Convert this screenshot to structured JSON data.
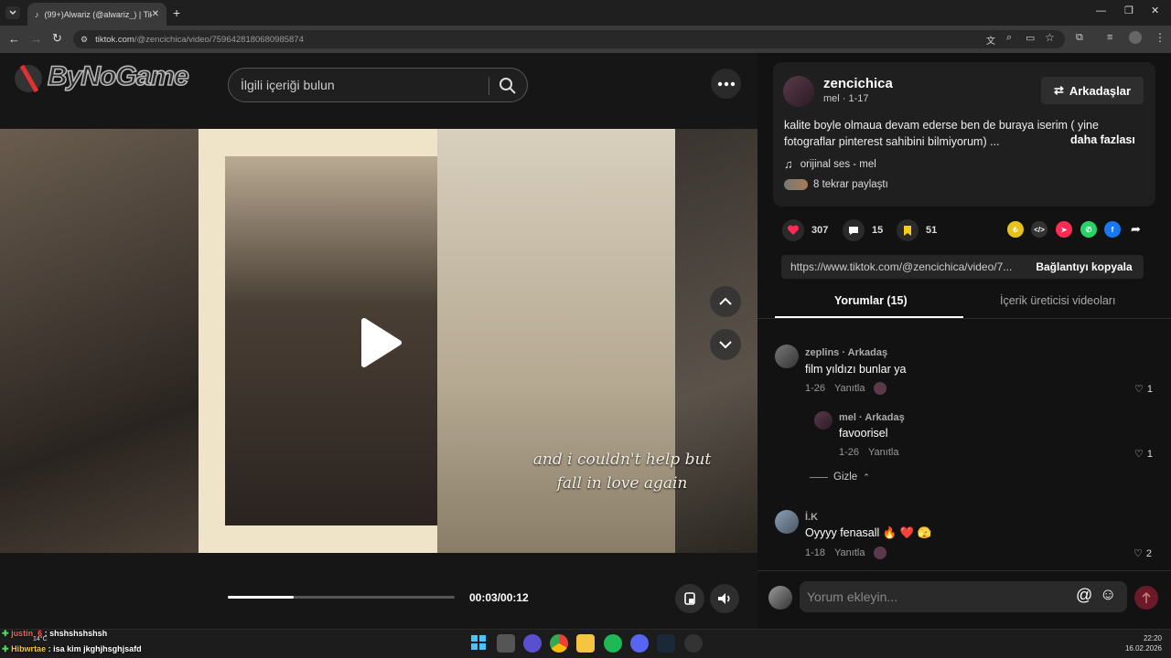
{
  "browser": {
    "tab_title": "(99+)Alwariz (@alwariz_) | TikTo",
    "url_host": "tiktok.com",
    "url_path": "/@zencichica/video/7596428180680985874"
  },
  "header": {
    "logo_text": "ByNoGame",
    "search_placeholder": "İlgili içeriği bulun"
  },
  "video": {
    "caption_line1": "and i couldn't help but",
    "caption_line2": "fall in love again",
    "time": "00:03/00:12",
    "progress": 0.29
  },
  "post": {
    "author": "zencichica",
    "author_sub": "mel · 1-17",
    "friends_button": "Arkadaşlar",
    "description": "kalite boyle olmaua devam ederse ben de buraya iserim ( yine fotograflar pinterest sahibini bilmiyorum) ...",
    "more_label": "daha fazlası",
    "music": "orijinal ses - mel",
    "shares": "8 tekrar paylaştı",
    "likes": "307",
    "comments": "15",
    "saves": "51",
    "link": "https://www.tiktok.com/@zencichica/video/7...",
    "copy_label": "Bağlantıyı kopyala"
  },
  "tabs": {
    "comments": "Yorumlar (15)",
    "creator_videos": "İçerik üreticisi videoları"
  },
  "comments": [
    {
      "name": "zeplins · Arkadaş",
      "text": "film yıldızı bunlar ya",
      "date": "1-26",
      "reply": "Yanıtla",
      "likes": "1"
    },
    {
      "name": "mel · Arkadaş",
      "text": "favoorisel",
      "date": "1-26",
      "reply": "Yanıtla",
      "likes": "1"
    },
    {
      "name": "İ.K",
      "text": "Oyyyy fenasall 🔥 ❤️ 🫣",
      "date": "1-18",
      "reply": "Yanıtla",
      "likes": "2"
    }
  ],
  "hide_label": "Gizle",
  "comment_placeholder": "Yorum ekleyin...",
  "overlay_chat": {
    "line1_user": "justin_6",
    "line1_text": ": shshshshshsh",
    "line2_user": "Hibwrtae",
    "line2_text": ": isa kim jkghjhsghjsafd",
    "weather": "14°C"
  },
  "clock": {
    "time": "22:20",
    "date": "16.02.2026"
  },
  "colors": {
    "accent": "#fe2c55",
    "bg": "#121212"
  }
}
